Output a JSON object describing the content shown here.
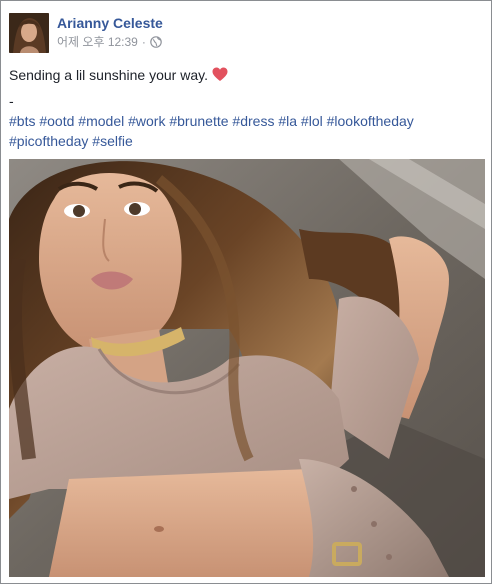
{
  "post": {
    "author_name": "Arianny Celeste",
    "timestamp": "어제 오후 12:39",
    "separator": "·",
    "privacy_icon": "globe-icon",
    "text_line_1": "Sending a lil sunshine your way.",
    "emoji": "heart-emoji",
    "dash_line": "-",
    "hashtags_line_1": [
      "#bts",
      "#ootd",
      "#model",
      "#work",
      "#brunette",
      "#dress",
      "#la",
      "#lol",
      "#lookoftheday"
    ],
    "hashtags_line_2": [
      "#picoftheday",
      "#selfie"
    ],
    "photo_icon": "selfie-photo"
  },
  "colors": {
    "link": "#365899",
    "text": "#1d2129",
    "meta": "#90949c",
    "heart": "#e2515e",
    "border": "#8a8d91"
  }
}
